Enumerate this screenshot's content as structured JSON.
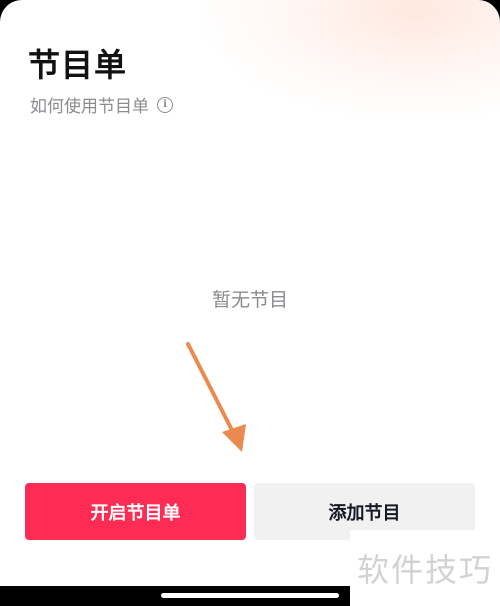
{
  "header": {
    "title": "节目单",
    "help_text": "如何使用节目单",
    "help_icon": "info-icon"
  },
  "main": {
    "empty_text": "暂无节目"
  },
  "actions": {
    "start_label": "开启节目单",
    "add_label": "添加节目"
  },
  "colors": {
    "primary": "#fe2c55",
    "secondary": "#f1f1f2",
    "annotation_arrow": "#ea8a4f"
  },
  "watermark": "软件技巧"
}
